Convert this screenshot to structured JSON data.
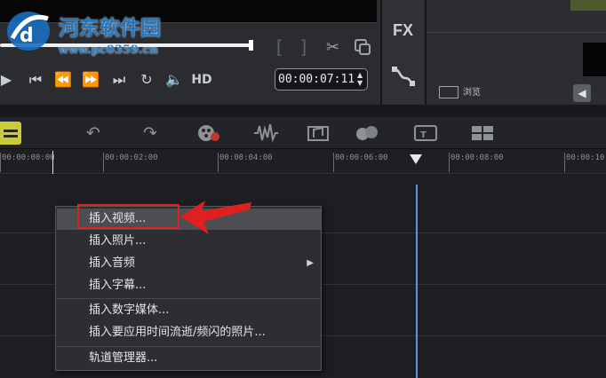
{
  "watermark": {
    "title": "河东软件园",
    "url": "www.pc0359.cn"
  },
  "preview": {
    "timecode": "00:00:07:11",
    "hd_label": "HD",
    "brackets": [
      "[",
      "]"
    ]
  },
  "side": {
    "fx_label": "FX"
  },
  "library": {
    "browse_label": "浏览"
  },
  "ruler": {
    "labels": [
      "00:00:00:00",
      "00:00:02:00",
      "00:00:04:00",
      "00:00:06:00",
      "00:00:08:00",
      "00:00:10"
    ]
  },
  "context_menu": {
    "items": [
      {
        "label": "插入视频..."
      },
      {
        "label": "插入照片..."
      },
      {
        "label": "插入音频"
      },
      {
        "label": "插入字幕..."
      },
      {
        "label": "插入数字媒体..."
      },
      {
        "label": "插入要应用时间流逝/频闪的照片..."
      },
      {
        "label": "轨道管理器..."
      }
    ],
    "highlighted_index": 0,
    "submenu_index": 2
  },
  "colors": {
    "annotation": "#e02020",
    "watermark_blue": "#1e77c4",
    "selected_tool": "#c9cb3a",
    "playhead_line": "#6b8fd6"
  }
}
